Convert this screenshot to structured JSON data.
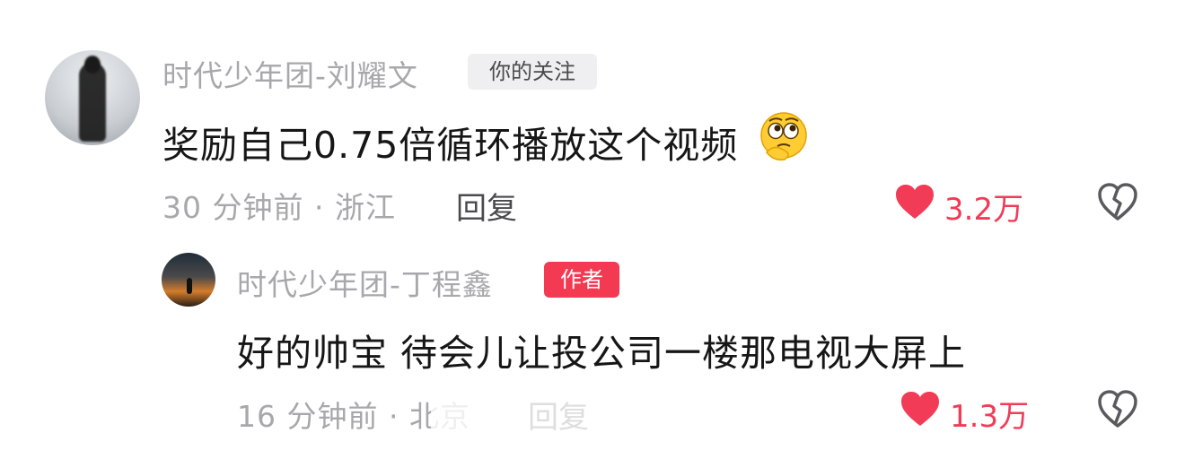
{
  "comments": [
    {
      "username": "时代少年团-刘耀文",
      "tag": "你的关注",
      "content": "奖励自己0.75倍循环播放这个视频",
      "emoji": "thinking-face-emoji",
      "time_location": "30 分钟前 · 浙江",
      "reply_label": "回复",
      "likes": "3.2万",
      "liked": true
    },
    {
      "username": "时代少年团-丁程鑫",
      "tag": "作者",
      "content": "好的帅宝 待会儿让投公司一楼那电视大屏上",
      "time_location": "16 分钟前 · 北京",
      "reply_label": "回复",
      "likes": "1.3万",
      "liked": true
    }
  ],
  "colors": {
    "like": "#f23b57",
    "author_tag": "#f33a52",
    "follow_tag_bg": "#efeff1",
    "meta_text": "#a8a8ac"
  },
  "icons": {
    "like": "heart-icon",
    "dislike": "broken-heart-icon"
  }
}
